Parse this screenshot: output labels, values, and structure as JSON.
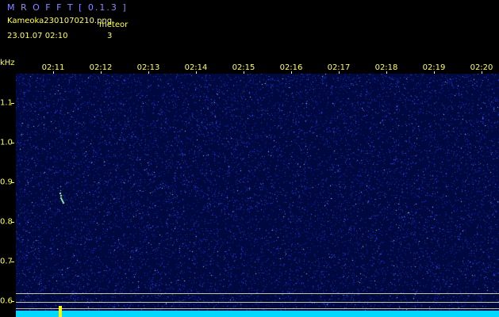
{
  "header": {
    "app_title": "M R O F F T [ 0.1.3 ]",
    "file_name": "Kameoka2301070210.png",
    "meteor_label": "meteor",
    "timestamp": "23.01.07 02:10",
    "meteor_count": "3"
  },
  "axes": {
    "freq_unit": "kHz",
    "time_labels": [
      "02:11",
      "02:12",
      "02:13",
      "02:14",
      "02:15",
      "02:16",
      "02:17",
      "02:18",
      "02:19",
      "02:20"
    ],
    "freq_labels": [
      "1.1",
      "1.0",
      "0.9",
      "0.8",
      "0.7",
      "0.6"
    ]
  },
  "colors": {
    "background": "#000000",
    "spectrogram": "#000840",
    "label": "#ffff55",
    "title": "#8a8aff",
    "noise_floor": "#00d8ff"
  }
}
